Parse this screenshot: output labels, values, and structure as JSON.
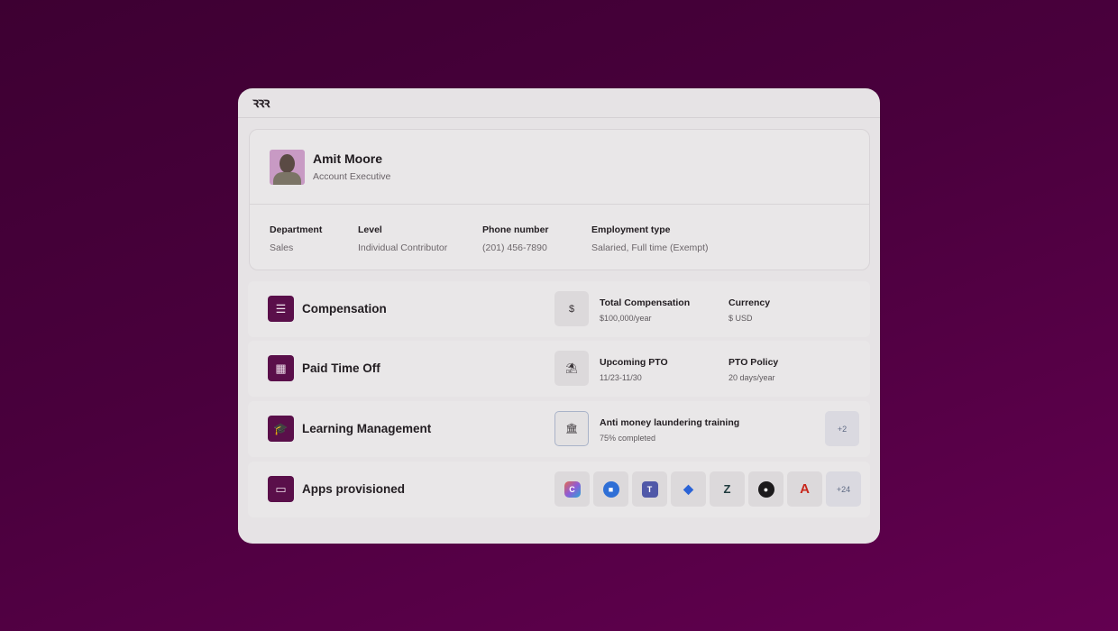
{
  "app": {
    "logo": "ꝛꝛꝛ"
  },
  "profile": {
    "name": "Amit Moore",
    "title": "Account Executive",
    "facts": [
      {
        "label": "Department",
        "value": "Sales"
      },
      {
        "label": "Level",
        "value": "Individual Contributor"
      },
      {
        "label": "Phone number",
        "value": "(201) 456-7890"
      },
      {
        "label": "Employment type",
        "value": "Salaried, Full time (Exempt)"
      }
    ]
  },
  "sections": {
    "compensation": {
      "title": "Compensation",
      "icon": "coins-icon",
      "info_icon": "dollar-circle-icon",
      "stat1_label": "Total Compensation",
      "stat1_value": "$100,000/year",
      "stat2_label": "Currency",
      "stat2_value": "$ USD"
    },
    "pto": {
      "title": "Paid Time Off",
      "icon": "calendar-icon",
      "info_icon": "beach-icon",
      "stat1_label": "Upcoming PTO",
      "stat1_value": "11/23-11/30",
      "stat2_label": "PTO Policy",
      "stat2_value": "20 days/year"
    },
    "learning": {
      "title": "Learning Management",
      "icon": "graduation-cap-icon",
      "info_icon": "bank-icon",
      "course_label": "Anti money laundering training",
      "progress_text": "75% completed",
      "progress": 0.75,
      "more": "+2"
    },
    "apps": {
      "title": "Apps provisioned",
      "icon": "laptop-icon",
      "items": [
        {
          "name": "copilot-icon",
          "color": "#d96b8c"
        },
        {
          "name": "zoom-icon",
          "color": "#2f6fd6"
        },
        {
          "name": "teams-icon",
          "color": "#5058a8"
        },
        {
          "name": "dropbox-icon",
          "color": "#2b63d6"
        },
        {
          "name": "zendesk-icon",
          "color": "#1f3a3d"
        },
        {
          "name": "github-icon",
          "color": "#1c1a1c"
        },
        {
          "name": "adobe-icon",
          "color": "#c8261b"
        }
      ],
      "more": "+24"
    }
  }
}
